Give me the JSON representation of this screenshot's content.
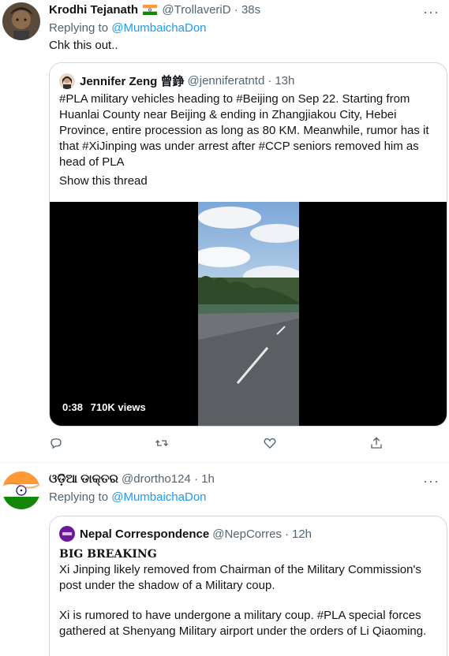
{
  "tweet1": {
    "author_name": "Krodhi Tejanath",
    "author_handle": "@TrollaveriD",
    "time": "38s",
    "flag_icon": "india-flag-icon",
    "replying_prefix": "Replying to",
    "replying_handle": "@MumbaichaDon",
    "text": "Chk this out..",
    "quote": {
      "author_name": "Jennifer Zeng 曾錚",
      "author_handle": "@jenniferatntd",
      "time": "13h",
      "text": "#PLA military vehicles heading to #Beijing on Sep 22. Starting from Huanlai County near Beijing & ending in Zhangjiakou City, Hebei Province, entire procession as long as 80 KM. Meanwhile, rumor has it that #XiJinping was under arrest after #CCP seniors removed him as head of PLA",
      "show_thread": "Show this thread",
      "video": {
        "duration": "0:38",
        "views": "710K views"
      }
    },
    "actions": [
      "reply-icon",
      "retweet-icon",
      "like-icon",
      "share-icon"
    ]
  },
  "tweet2": {
    "author_name": "ଓଡ଼ିଆ ଡାକ୍ତର",
    "author_handle": "@drortho124",
    "time": "1h",
    "replying_prefix": "Replying to",
    "replying_handle": "@MumbaichaDon",
    "quote": {
      "author_name": "Nepal Correspondence",
      "author_handle": "@NepCorres",
      "time": "12h",
      "headline": "BIG BREAKING",
      "para1": "Xi Jinping likely removed from Chairman of the Military Commission's post under the shadow of a Military coup.",
      "para2": "Xi is rumored to have undergone a military coup. #PLA special forces gathered at Shenyang Military airport under the orders of Li Qiaoming."
    }
  },
  "separator": "·",
  "more_glyph": "···",
  "colors": {
    "link": "#1d9bf0",
    "muted": "#536471",
    "border": "#cfd9de",
    "text": "#0f1419"
  }
}
